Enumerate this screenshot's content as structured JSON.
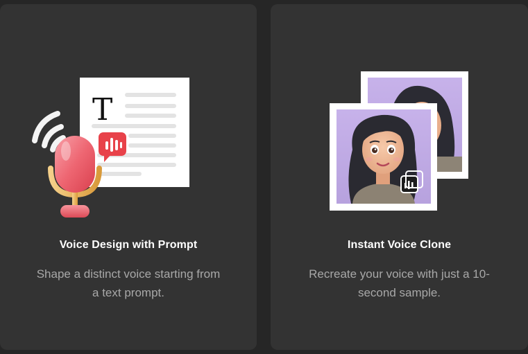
{
  "cards": [
    {
      "title": "Voice Design with Prompt",
      "description": "Shape a distinct voice starting from a text prompt.",
      "illustration": "microphone-document-icon"
    },
    {
      "title": "Instant Voice Clone",
      "description": "Recreate your voice with just a 10-second sample.",
      "illustration": "photo-clone-icon"
    }
  ],
  "document_glyph": "T",
  "colors": {
    "background": "#262626",
    "card": "#333333",
    "title": "#ffffff",
    "description": "#a8a8a8",
    "accent_red": "#e8424a",
    "mic_pink": "#f2707b",
    "mic_gold": "#e8b85a",
    "photo_bg": "#c9b5ea"
  }
}
